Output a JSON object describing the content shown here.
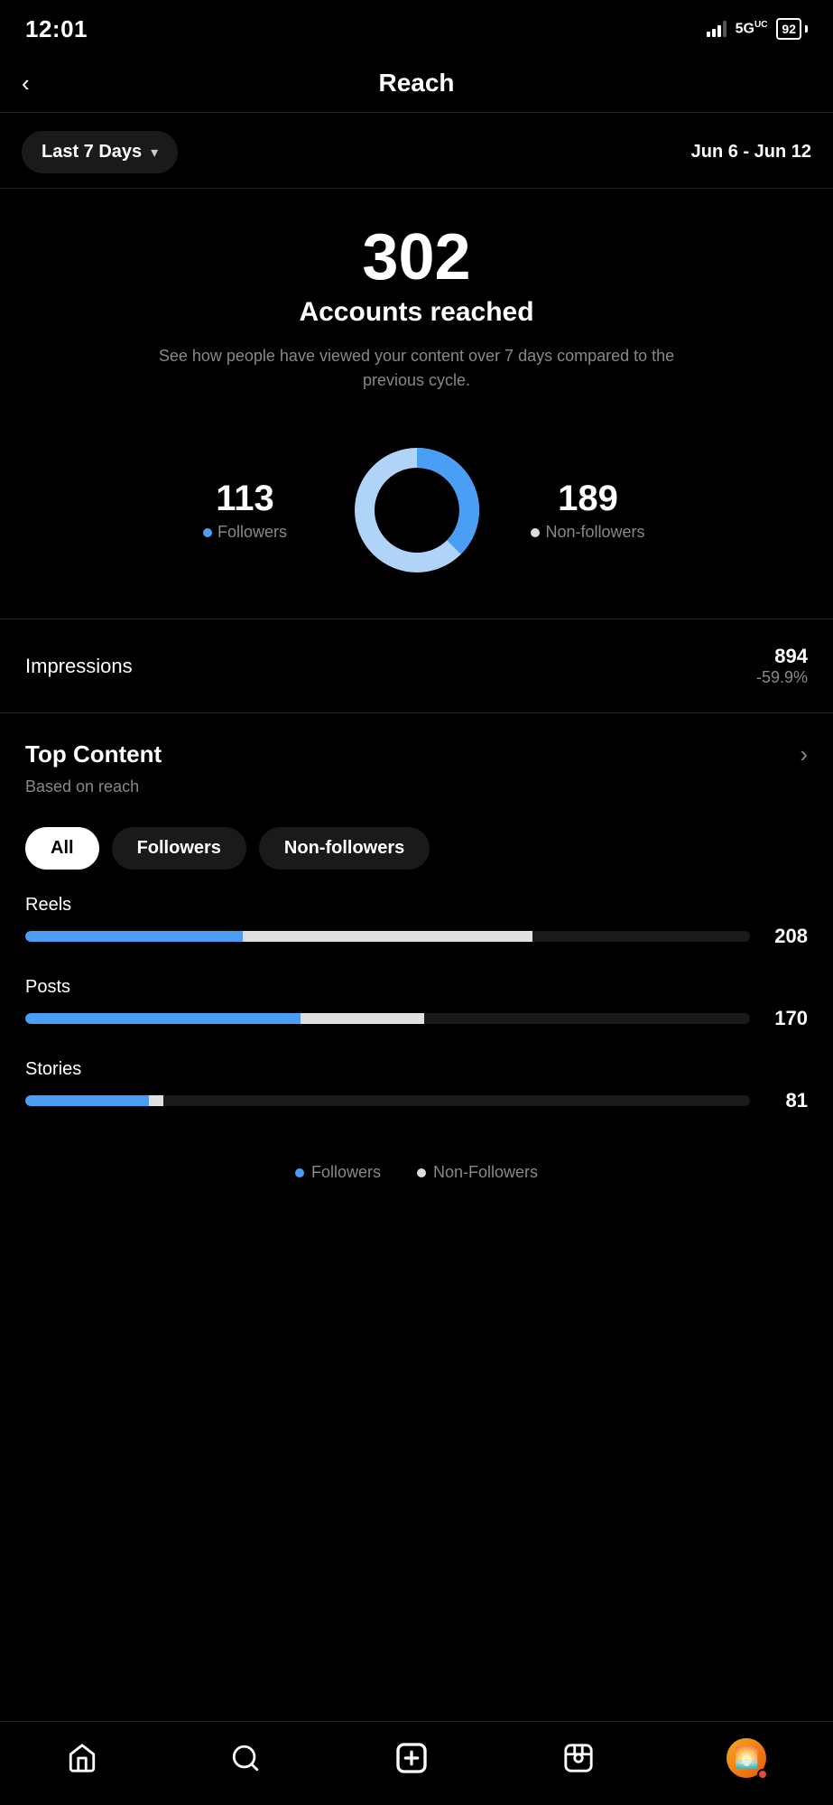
{
  "statusBar": {
    "time": "12:01",
    "network": "5Gᵁ",
    "battery": "92"
  },
  "header": {
    "title": "Reach",
    "backLabel": "‹"
  },
  "dateFilter": {
    "label": "Last 7 Days",
    "range": "Jun 6 - Jun 12"
  },
  "accountsReached": {
    "number": "302",
    "label": "Accounts reached",
    "description": "See how people have viewed your content over 7 days compared to the previous cycle."
  },
  "donut": {
    "followersCount": "113",
    "followersLabel": "Followers",
    "nonFollowersCount": "189",
    "nonFollowersLabel": "Non-followers",
    "followersPercent": 37.4,
    "nonFollowersPercent": 62.6
  },
  "impressions": {
    "label": "Impressions",
    "number": "894",
    "change": "-59.9%"
  },
  "topContent": {
    "title": "Top Content",
    "subtitle": "Based on reach",
    "chevron": "›"
  },
  "filterTabs": [
    {
      "label": "All",
      "active": true
    },
    {
      "label": "Followers",
      "active": false
    },
    {
      "label": "Non-followers",
      "active": false
    }
  ],
  "bars": [
    {
      "label": "Reels",
      "value": "208",
      "blueWidth": 30,
      "whiteWidth": 40
    },
    {
      "label": "Posts",
      "value": "170",
      "blueWidth": 40,
      "whiteWidth": 18
    },
    {
      "label": "Stories",
      "value": "81",
      "blueWidth": 18,
      "whiteWidth": 2
    }
  ],
  "legend": {
    "followersLabel": "Followers",
    "nonFollowersLabel": "Non-Followers"
  },
  "nav": {
    "home": "⌂",
    "search": "○",
    "add": "＋",
    "reels": "▶",
    "profile": "👤"
  }
}
